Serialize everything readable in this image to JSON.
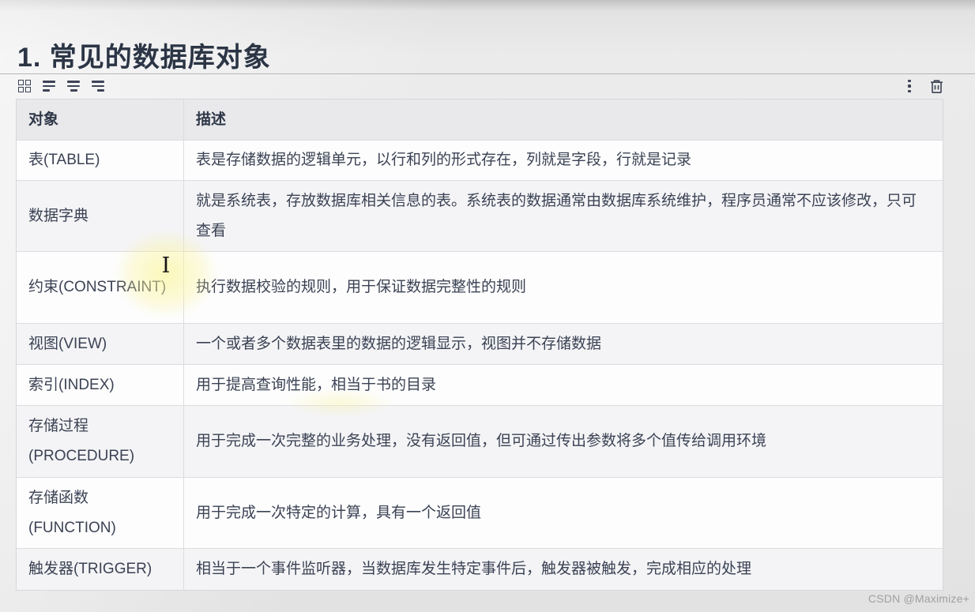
{
  "page": {
    "title": "1. 常见的数据库对象",
    "watermark": "CSDN @Maximize+"
  },
  "toolbar": {
    "left_icons": [
      {
        "name": "grid-icon"
      },
      {
        "name": "align-left-icon"
      },
      {
        "name": "align-center-icon"
      },
      {
        "name": "align-right-icon"
      }
    ],
    "right_icons": [
      {
        "name": "kebab-menu-icon"
      },
      {
        "name": "trash-icon"
      }
    ]
  },
  "table": {
    "columns": [
      "对象",
      "描述"
    ],
    "rows": [
      {
        "object": "表(TABLE)",
        "description": "表是存储数据的逻辑单元，以行和列的形式存在，列就是字段，行就是记录"
      },
      {
        "object": "数据字典",
        "description": "就是系统表，存放数据库相关信息的表。系统表的数据通常由数据库系统维护，程序员通常不应该修改，只可查看"
      },
      {
        "object": "约束(CONSTRAINT)",
        "description": "执行数据校验的规则，用于保证数据完整性的规则"
      },
      {
        "object": "视图(VIEW)",
        "description": "一个或者多个数据表里的数据的逻辑显示，视图并不存储数据"
      },
      {
        "object": "索引(INDEX)",
        "description": "用于提高查询性能，相当于书的目录"
      },
      {
        "object": "存储过程(PROCEDURE)",
        "description": "用于完成一次完整的业务处理，没有返回值，但可通过传出参数将多个值传给调用环境"
      },
      {
        "object": "存储函数(FUNCTION)",
        "description": "用于完成一次特定的计算，具有一个返回值"
      },
      {
        "object": "触发器(TRIGGER)",
        "description": "相当于一个事件监听器，当数据库发生特定事件后，触发器被触发，完成相应的处理"
      }
    ]
  },
  "colors": {
    "title_text": "#2b3545",
    "cell_text": "#3b4254",
    "header_bg": "#e9e9ec",
    "stripe_bg": "#f4f4f6",
    "row_bg": "#fdfdfd",
    "border": "#dcdcdf",
    "icon": "#3d4456",
    "highlight_glow": "#faf496",
    "watermark_text": "#a0a0a2"
  }
}
